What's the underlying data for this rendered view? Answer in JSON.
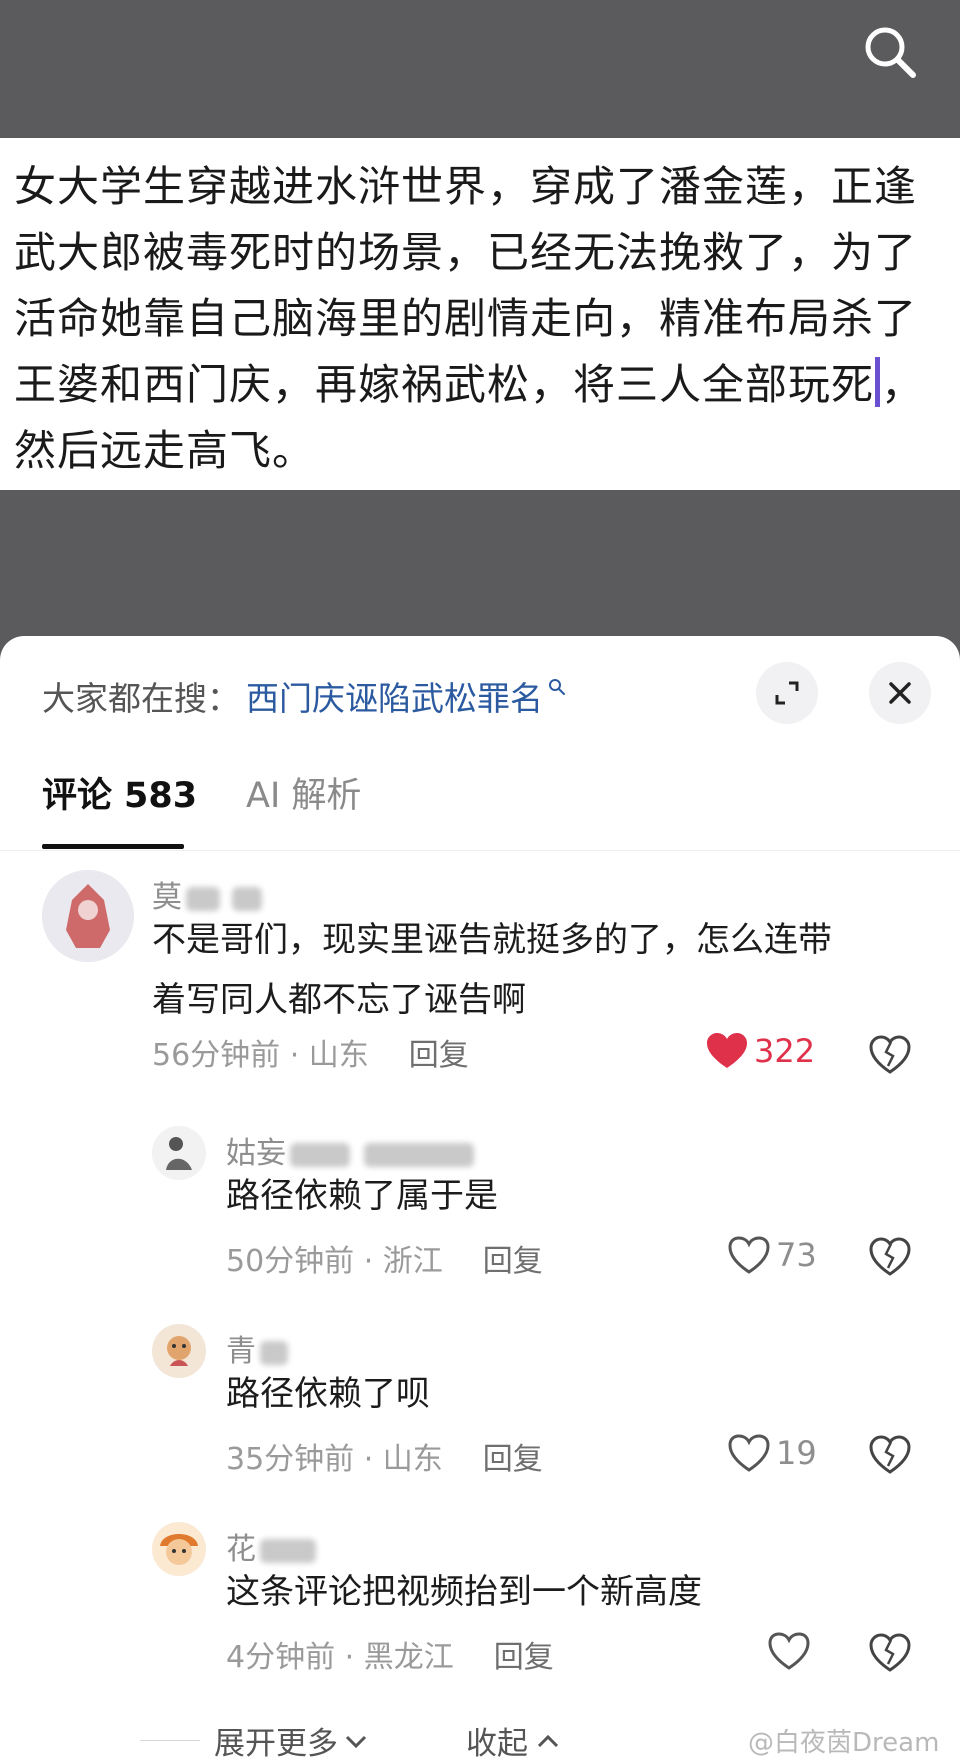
{
  "video": {
    "caption_lines": [
      "女大学生穿越进水浒世界，穿成了潘金莲，正逢",
      "武大郎被毒死时的场景，已经无法挽救了，为了",
      "活命她靠自己脑海里的剧情走向，精准布局杀了",
      "王婆和西门庆，再嫁祸武松，将三人全部玩死",
      "，",
      "然后远走高飞。"
    ]
  },
  "hot_search": {
    "label": "大家都在搜：",
    "query": "西门庆诬陷武松罪名"
  },
  "tabs": {
    "comments_label": "评论",
    "comments_count": "583",
    "ai_label": "AI 解析"
  },
  "comments": [
    {
      "name": "莫",
      "text_line1": "不是哥们，现实里诬告就挺多的了，怎么连带",
      "text_line2": "着写同人都不忘了诬告啊",
      "time": "56分钟前",
      "location": "山东",
      "reply": "回复",
      "likes": "322",
      "liked": true
    },
    {
      "name": "姑妄",
      "text_line1": "路径依赖了属于是",
      "time": "50分钟前",
      "location": "浙江",
      "reply": "回复",
      "likes": "73",
      "liked": false
    },
    {
      "name": "青",
      "text_line1": "路径依赖了呗",
      "time": "35分钟前",
      "location": "山东",
      "reply": "回复",
      "likes": "19",
      "liked": false
    },
    {
      "name": "花",
      "text_line1": "这条评论把视频抬到一个新高度",
      "time": "4分钟前",
      "location": "黑龙江",
      "reply": "回复",
      "likes": "",
      "liked": false
    }
  ],
  "footer": {
    "expand_more": "展开更多",
    "collapse": "收起",
    "watermark": "@白夜茵Dream"
  },
  "colors": {
    "like_active": "#e0314b",
    "link": "#2c5aa0",
    "backdrop": "#5b5b5d"
  },
  "icons": [
    "search-icon",
    "expand-icon",
    "close-icon",
    "heart-icon",
    "dislike-icon",
    "chevron-down-icon",
    "chevron-up-icon"
  ]
}
